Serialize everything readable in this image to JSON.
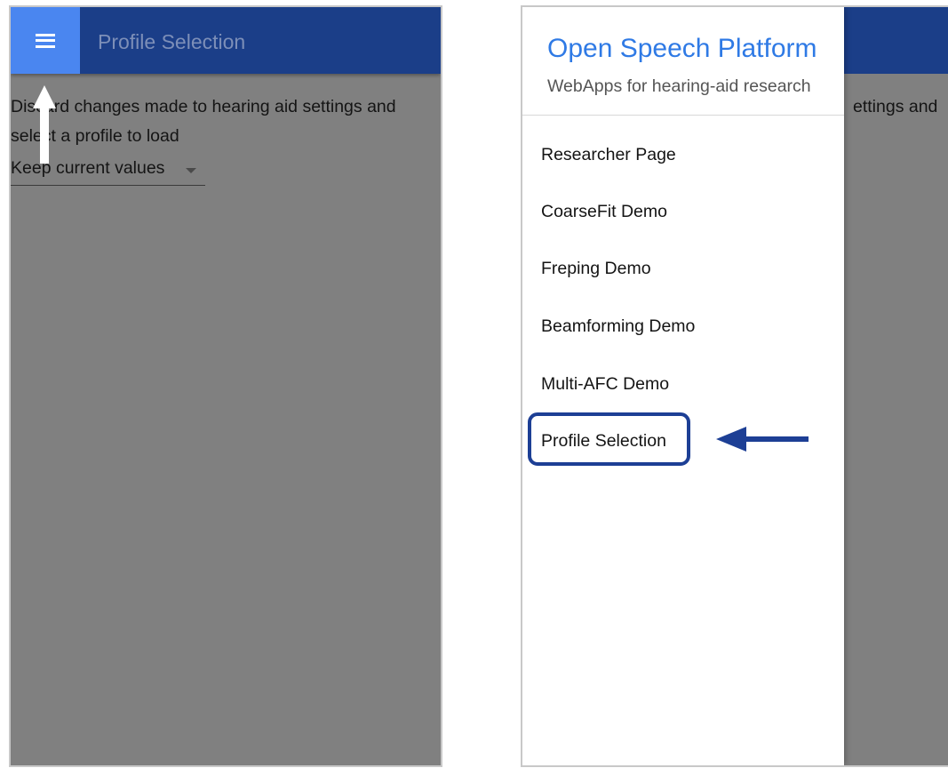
{
  "left_screen": {
    "appbar": {
      "title": "Profile Selection",
      "menu_icon": "hamburger-menu-icon",
      "color": "#1b3e88",
      "menu_button_color": "#4a86f0"
    },
    "message_line1": "Discard changes made to hearing aid settings and",
    "message_line2": "select a profile to load",
    "profile_select": {
      "selected": "Keep current values",
      "icon": "caret-down-icon"
    },
    "annotation": {
      "icon": "up-arrow-icon",
      "color": "#ffffff"
    }
  },
  "right_screen": {
    "background_text": "ettings and",
    "drawer": {
      "title": "Open Speech Platform",
      "subtitle": "WebApps for hearing-aid research",
      "items": [
        {
          "label": "Researcher Page"
        },
        {
          "label": "CoarseFit Demo"
        },
        {
          "label": "Freping Demo"
        },
        {
          "label": "Beamforming Demo"
        },
        {
          "label": "Multi-AFC Demo"
        },
        {
          "label": "Profile Selection"
        }
      ],
      "title_color": "#2f7ae5"
    },
    "annotation": {
      "icon": "left-arrow-icon",
      "highlight_color": "#1d3f95"
    }
  }
}
